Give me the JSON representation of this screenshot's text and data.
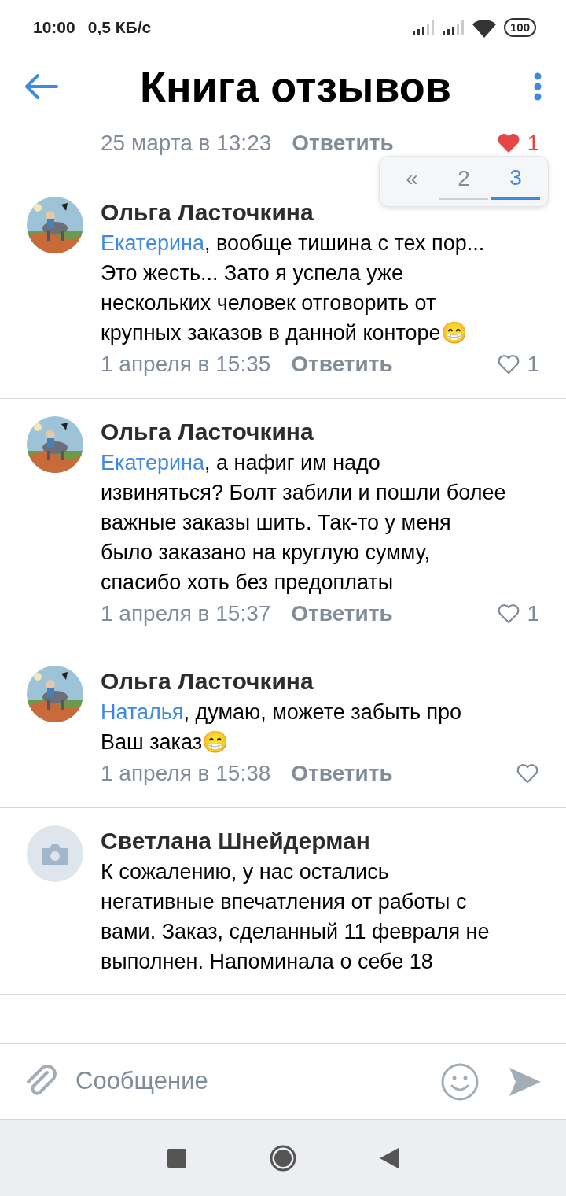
{
  "status_bar": {
    "time": "10:00",
    "speed": "0,5 КБ/с",
    "battery": "100"
  },
  "header": {
    "title": "Книга отзывов"
  },
  "previous_comment": {
    "date": "25 марта в 13:23",
    "reply": "Ответить",
    "liked": true,
    "likes": "1"
  },
  "pager": [
    {
      "label": "«",
      "selected": false
    },
    {
      "label": "2",
      "selected": false
    },
    {
      "label": "3",
      "selected": true
    }
  ],
  "comments": [
    {
      "author": "Ольга Ласточкина",
      "mention": "Екатерина",
      "text": ", вообще тишина с тех пор... Это жесть... Зато я успела уже нескольких человек отговорить от крупных заказов в данной конторе😁",
      "date": "1 апреля в 15:35",
      "reply": "Ответить",
      "liked": false,
      "likes": "1"
    },
    {
      "author": "Ольга Ласточкина",
      "mention": "Екатерина",
      "text": ", а нафиг им надо извиняться? Болт забили и пошли более важные заказы шить. Так-то у меня было заказано на круглую сумму, спасибо хоть без предоплаты",
      "date": "1 апреля в 15:37",
      "reply": "Ответить",
      "liked": false,
      "likes": "1"
    },
    {
      "author": "Ольга Ласточкина",
      "mention": "Наталья",
      "text": ", думаю, можете забыть про Ваш заказ😁",
      "date": "1 апреля в 15:38",
      "reply": "Ответить",
      "liked": false
    },
    {
      "author": "Светлана Шнейдерман",
      "avatar": {
        "kind": "placeholder"
      },
      "text": "К сожалению, у нас остались негативные впечатления от работы с вами. Заказ, сделанный 11 февраля не выполнен. Напоминала о себе 18"
    }
  ],
  "composer": {
    "placeholder": "Сообщение"
  }
}
